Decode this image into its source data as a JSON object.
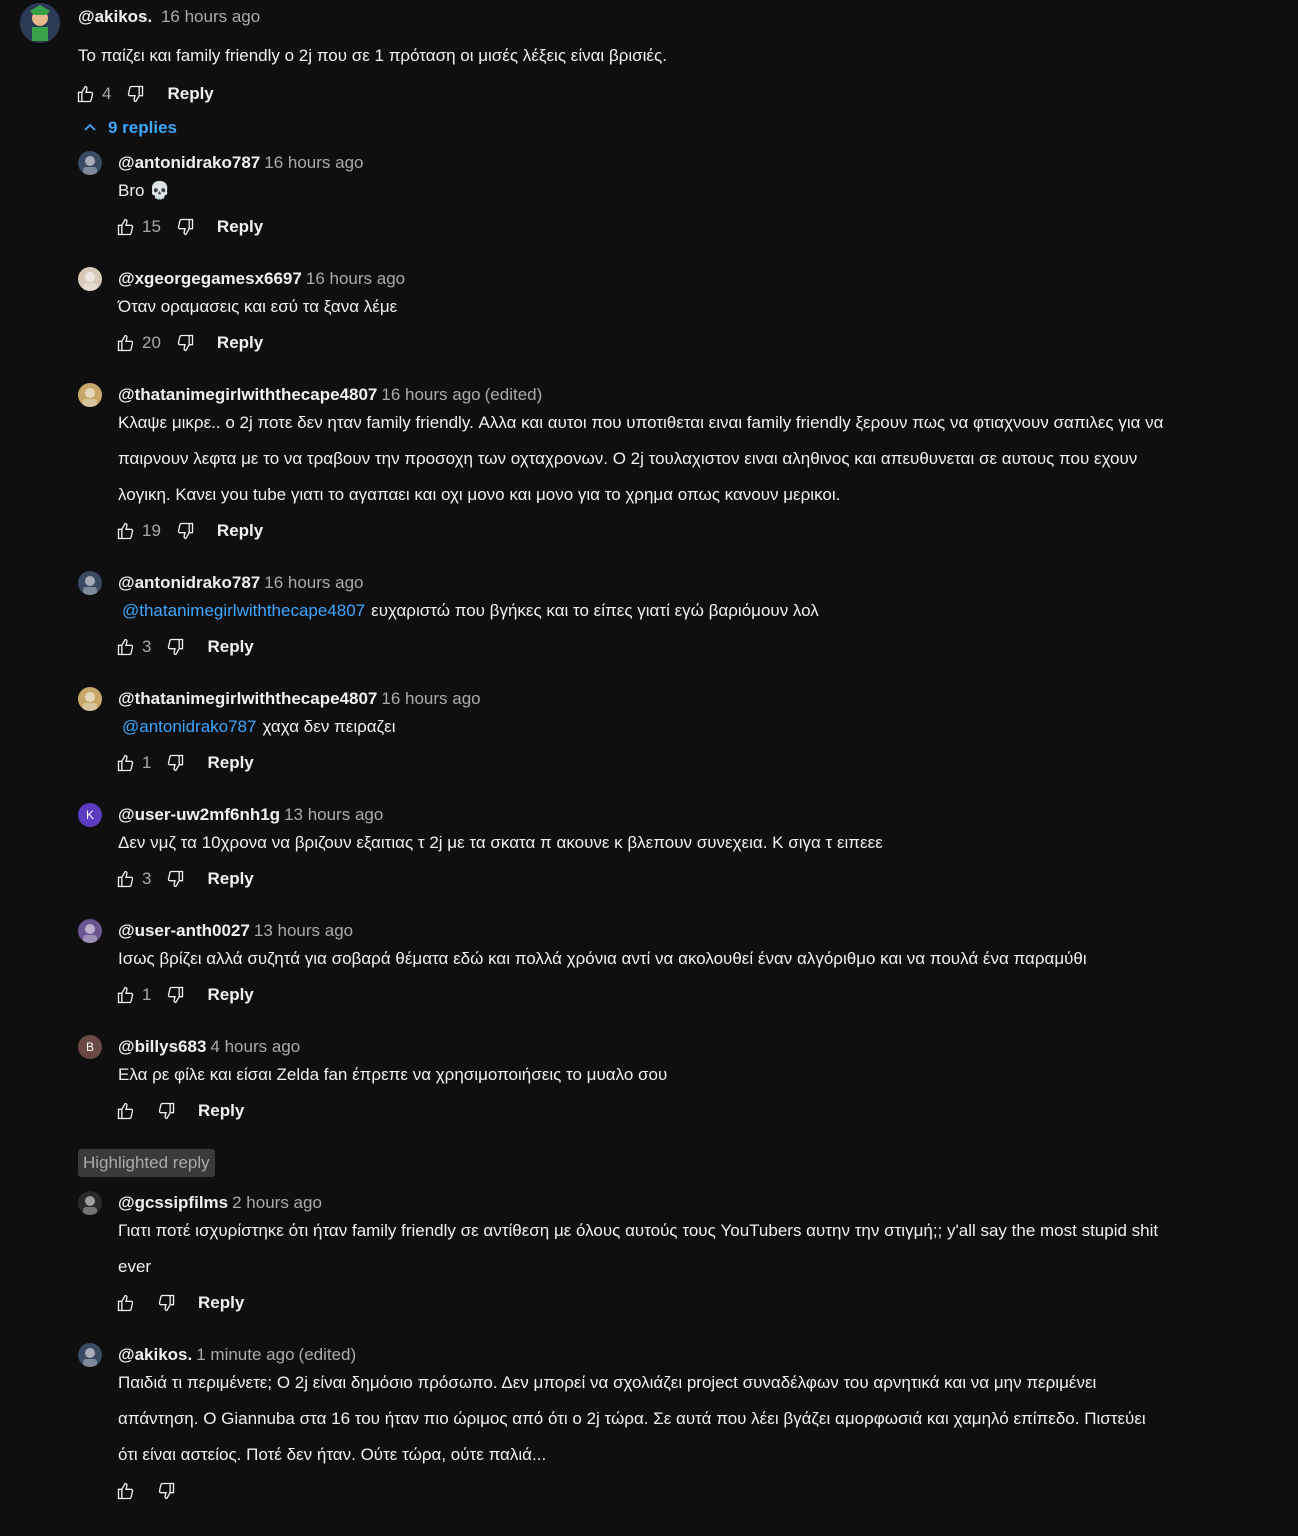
{
  "top_comment": {
    "author": "@akikos.",
    "time": "16 hours ago",
    "text": "Το παίζει και family friendly ο 2j που σε 1 πρόταση οι μισές λέξεις είναι βρισιές.",
    "likes": "4",
    "reply_label": "Reply",
    "replies_toggle": "9 replies"
  },
  "replies": [
    {
      "author": "@antonidrako787",
      "time": "16 hours ago",
      "text": "Bro 💀",
      "likes": "15",
      "reply_label": "Reply"
    },
    {
      "author": "@xgeorgegamesx6697",
      "time": "16 hours ago",
      "text": "Όταν οραμασεις και εσύ τα ξανα λέμε",
      "likes": "20",
      "reply_label": "Reply"
    },
    {
      "author": "@thatanimegirlwiththecape4807",
      "time": "16 hours ago",
      "edited": "(edited)",
      "text_lines": [
        "Κλαψε μικρε.. ο 2j ποτε δεν ηταν family friendly. Αλλα και αυτοι που υποτιθεται ειναι family friendly ξερουν πως να φτιαχνουν σαπιλες για να",
        "παιρνουν λεφτα με το να τραβουν την προσοχη των οχταχρονων. Ο 2j τουλαχιστον ειναι αληθινος και απευθυνεται σε αυτους που εχουν",
        "λογικη. Κανει you tube γιατι το αγαπαει και οχι μονο και μονο για το χρημα οπως κανουν μερικοι."
      ],
      "likes": "19",
      "reply_label": "Reply"
    },
    {
      "author": "@antonidrako787",
      "time": "16 hours ago",
      "mention": "@thatanimegirlwiththecape4807",
      "text": "ευχαριστώ που βγήκες και το είπες γιατί εγώ βαριόμουν λολ",
      "likes": "3",
      "reply_label": "Reply"
    },
    {
      "author": "@thatanimegirlwiththecape4807",
      "time": "16 hours ago",
      "mention": "@antonidrako787",
      "text": "χαχα δεν πειραζει",
      "likes": "1",
      "reply_label": "Reply"
    },
    {
      "author": "@user-uw2mf6nh1g",
      "time": "13 hours ago",
      "avatar_letter": "K",
      "text": "Δεν νμζ τα 10χρονα να βριζουν εξαιτιας τ 2j με τα σκατα π ακουνε κ βλεπουν συνεχεια. Κ σιγα τ ειπεεε",
      "likes": "3",
      "reply_label": "Reply"
    },
    {
      "author": "@user-anth0027",
      "time": "13 hours ago",
      "text": "Ισως βρίζει αλλά συζητά για σοβαρά θέματα εδώ και πολλά χρόνια αντί να ακολουθεί έναν αλγόριθμο και να πουλά ένα παραμύθι",
      "likes": "1",
      "reply_label": "Reply"
    },
    {
      "author": "@billys683",
      "time": "4 hours ago",
      "avatar_letter": "B",
      "text": "Ελα ρε φίλε και είσαι Zelda fan έπρεπε να χρησιμοποιήσεις το μυαλο σου",
      "likes": "",
      "reply_label": "Reply"
    }
  ],
  "highlighted_label": "Highlighted reply",
  "highlighted": [
    {
      "author": "@gcssipfilms",
      "time": "2 hours ago",
      "text_lines": [
        "Γιατι ποτέ ισχυρίστηκε ότι ήταν family friendly σε αντίθεση με όλους αυτούς τους YouTubers αυτην την στιγμή;; y'all say the most stupid shit",
        "ever"
      ],
      "likes": "",
      "reply_label": "Reply"
    },
    {
      "author": "@akikos.",
      "time": "1 minute ago",
      "edited": "(edited)",
      "text_lines": [
        "Παιδιά τι περιμένετε; Ο 2j είναι δημόσιο πρόσωπο. Δεν μπορεί να σχολιάζει project συναδέλφων του αρνητικά και να μην περιμένει",
        "απάντηση. Ο Giannuba στα 16 του ήταν πιο ώριμος από ότι ο 2j τώρα. Σε αυτά που λέει βγάζει αμορφωσιά και χαμηλό επίπεδο. Πιστεύει",
        "ότι είναι αστείος. Ποτέ δεν ήταν. Ούτε τώρα, ούτε παλιά..."
      ],
      "likes": ""
    }
  ],
  "colors": {
    "background": "#0f0f0f",
    "text": "#f1f1f1",
    "secondary": "#aaaaaa",
    "link": "#3ea6ff"
  }
}
